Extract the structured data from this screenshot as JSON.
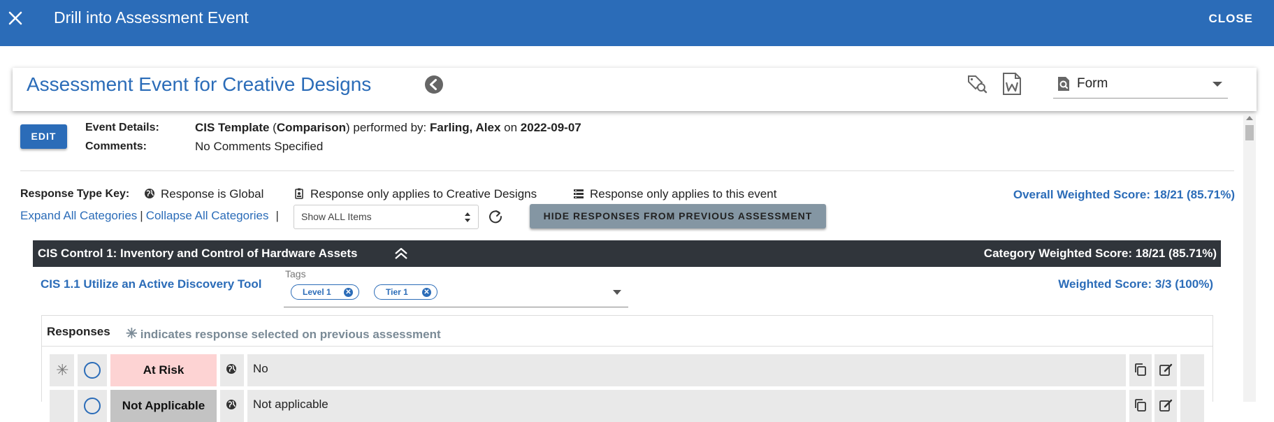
{
  "topbar": {
    "title": "Drill into Assessment Event",
    "close_label": "CLOSE"
  },
  "header": {
    "title": "Assessment Event for Creative Designs",
    "view_selected": "Form"
  },
  "event": {
    "edit_label": "EDIT",
    "details_label": "Event Details:",
    "comments_label": "Comments:",
    "template": "CIS Template",
    "paren_open": " (",
    "comparison": "Comparison",
    "performed_by_text": ") performed by: ",
    "performer": "Farling, Alex",
    "on_text": " on ",
    "date": "2022-09-07",
    "comments": "No Comments Specified"
  },
  "key": {
    "label": "Response Type Key:",
    "global": "Response is Global",
    "org": "Response only applies to Creative Designs",
    "event": "Response only applies to this event"
  },
  "overall_score": "Overall Weighted Score: 18/21 (85.71%)",
  "controls": {
    "expand": "Expand All Categories",
    "sep1": "|",
    "collapse": "Collapse All Categories",
    "sep2": "|",
    "show_filter": "Show ALL Items",
    "hide_prev": "HIDE RESPONSES FROM PREVIOUS ASSESSMENT"
  },
  "category": {
    "title": "CIS Control 1: Inventory and Control of Hardware Assets",
    "score": "Category Weighted Score: 18/21 (85.71%)"
  },
  "item": {
    "title": "CIS 1.1 Utilize an Active Discovery Tool",
    "tags_label": "Tags",
    "tags": [
      "Level 1",
      "Tier 1"
    ],
    "score": "Weighted Score: 3/3 (100%)"
  },
  "responses": {
    "heading": "Responses",
    "note_symbol": "✳",
    "note": "indicates response selected on previous assessment",
    "rows": [
      {
        "status": "At Risk",
        "text": "No"
      },
      {
        "status": "Not Applicable",
        "text": "Not applicable"
      }
    ]
  },
  "colors": {
    "primary": "#2b6cb8",
    "category_bar": "#30353b",
    "at_risk": "#fdd3d3",
    "not_applicable": "#c3c3c3"
  }
}
